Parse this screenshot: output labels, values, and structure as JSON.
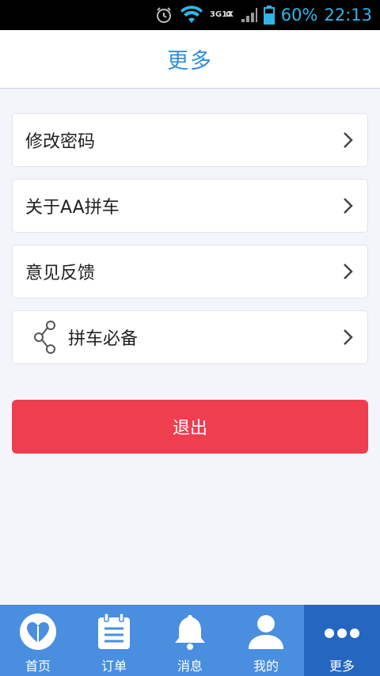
{
  "status_bar": {
    "network": [
      "3G",
      "1X",
      "G"
    ],
    "battery": "60%",
    "time": "22:13"
  },
  "header": {
    "title": "更多"
  },
  "menu": {
    "items": [
      {
        "label": "修改密码"
      },
      {
        "label": "关于AA拼车"
      },
      {
        "label": "意见反馈"
      },
      {
        "label": "拼车必备",
        "icon": "share-icon"
      }
    ]
  },
  "logout": {
    "label": "退出"
  },
  "tabs": [
    {
      "label": "首页",
      "icon": "heart-icon"
    },
    {
      "label": "订单",
      "icon": "clipboard-icon"
    },
    {
      "label": "消息",
      "icon": "bell-icon"
    },
    {
      "label": "我的",
      "icon": "user-icon"
    },
    {
      "label": "更多",
      "icon": "more-dots-icon",
      "active": true
    }
  ],
  "colors": {
    "accent": "#2f8fdc",
    "tab_bar": "#4a8ee0",
    "tab_active": "#2466c0",
    "logout": "#ef3e4f"
  }
}
